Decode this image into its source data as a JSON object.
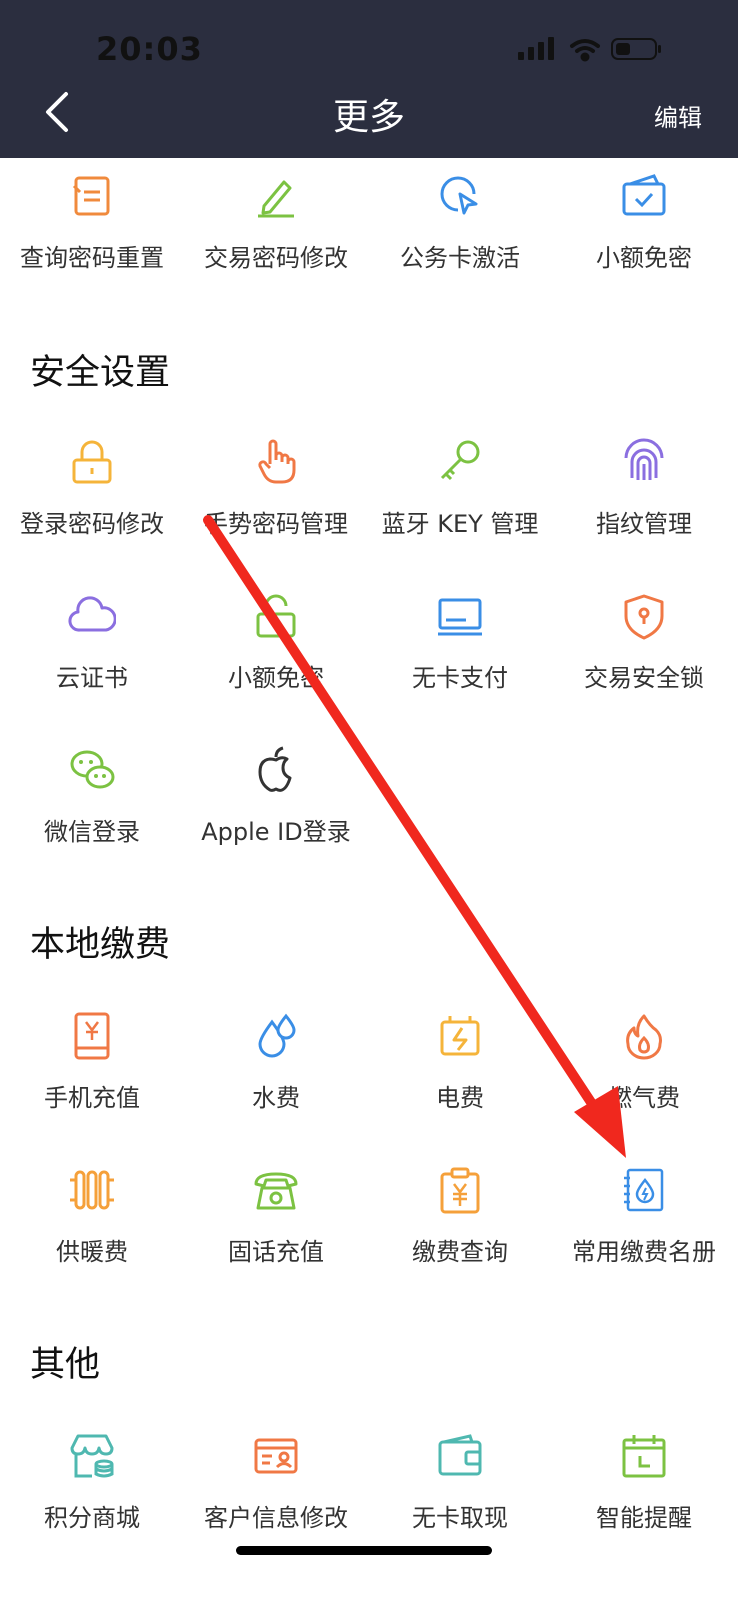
{
  "status_bar": {
    "time": "20:03"
  },
  "header": {
    "title": "更多",
    "edit_label": "编辑"
  },
  "top_row": [
    {
      "label": "查询密码重置",
      "icon": "form-reset-icon",
      "color": "#f08a3c"
    },
    {
      "label": "交易密码修改",
      "icon": "pencil-icon",
      "color": "#7cc242"
    },
    {
      "label": "公务卡激活",
      "icon": "cursor-click-icon",
      "color": "#3a8ee6"
    },
    {
      "label": "小额免密",
      "icon": "card-check-icon",
      "color": "#3a8ee6"
    }
  ],
  "sections": {
    "security": {
      "title": "安全设置",
      "items": [
        {
          "label": "登录密码修改",
          "icon": "lock-icon",
          "color": "#f5b43a"
        },
        {
          "label": "手势密码管理",
          "icon": "hand-pointer-icon",
          "color": "#f07845"
        },
        {
          "label": "蓝牙 KEY 管理",
          "icon": "key-icon",
          "color": "#7cc242"
        },
        {
          "label": "指纹管理",
          "icon": "fingerprint-icon",
          "color": "#8b6fe0"
        },
        {
          "label": "云证书",
          "icon": "cloud-icon",
          "color": "#8b6fe0"
        },
        {
          "label": "小额免密",
          "icon": "unlock-icon",
          "color": "#7cc242"
        },
        {
          "label": "无卡支付",
          "icon": "card-icon",
          "color": "#3a8ee6"
        },
        {
          "label": "交易安全锁",
          "icon": "shield-icon",
          "color": "#f07845"
        },
        {
          "label": "微信登录",
          "icon": "wechat-icon",
          "color": "#7cc242"
        },
        {
          "label": "Apple ID登录",
          "icon": "apple-icon",
          "color": "#333333"
        }
      ]
    },
    "payment": {
      "title": "本地缴费",
      "items": [
        {
          "label": "手机充值",
          "icon": "phone-yuan-icon",
          "color": "#f07845"
        },
        {
          "label": "水费",
          "icon": "water-drop-icon",
          "color": "#3a8ee6"
        },
        {
          "label": "电费",
          "icon": "battery-bolt-icon",
          "color": "#f5b43a"
        },
        {
          "label": "燃气费",
          "icon": "flame-icon",
          "color": "#f07845"
        },
        {
          "label": "供暖费",
          "icon": "radiator-icon",
          "color": "#f5a03a"
        },
        {
          "label": "固话充值",
          "icon": "telephone-icon",
          "color": "#7cc242"
        },
        {
          "label": "缴费查询",
          "icon": "clipboard-yuan-icon",
          "color": "#f5a03a"
        },
        {
          "label": "常用缴费名册",
          "icon": "bill-book-icon",
          "color": "#3a8ee6"
        }
      ]
    },
    "other": {
      "title": "其他",
      "items": [
        {
          "label": "积分商城",
          "icon": "store-icon",
          "color": "#4fb8b0"
        },
        {
          "label": "客户信息修改",
          "icon": "id-card-icon",
          "color": "#f07845"
        },
        {
          "label": "无卡取现",
          "icon": "wallet-icon",
          "color": "#4fb8b0"
        },
        {
          "label": "智能提醒",
          "icon": "calendar-icon",
          "color": "#7cc242"
        }
      ]
    }
  },
  "annotation": {
    "color": "#f0281e"
  }
}
